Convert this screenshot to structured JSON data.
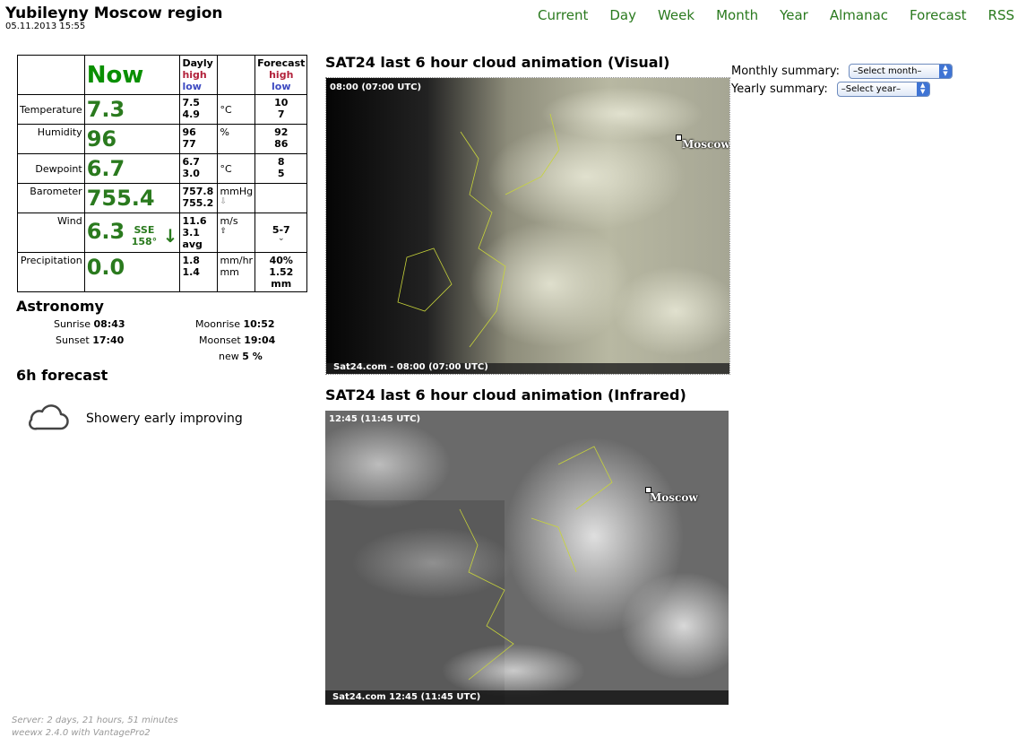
{
  "header": {
    "title": "Yubileyny Moscow region",
    "timestamp": "05.11.2013 15:55"
  },
  "nav": [
    "Current",
    "Day",
    "Week",
    "Month",
    "Year",
    "Almanac",
    "Forecast",
    "RSS"
  ],
  "table": {
    "now_label": "Now",
    "dayly_label": "Dayly",
    "forecast_label": "Forecast",
    "high": "high",
    "low": "low",
    "rows": [
      {
        "label": "Temperature",
        "now": "7.3",
        "hi": "7.5",
        "lo": "4.9",
        "unit": "°C",
        "fhi": "10",
        "flo": "7"
      },
      {
        "label": "Humidity",
        "now": "96",
        "hi": "96",
        "lo": "77",
        "unit": "%",
        "fhi": "92",
        "flo": "86"
      },
      {
        "label": "Dewpoint",
        "now": "6.7",
        "hi": "6.7",
        "lo": "3.0",
        "unit": "°C",
        "fhi": "8",
        "flo": "5"
      },
      {
        "label": "Barometer",
        "now": "755.4",
        "hi": "757.8",
        "lo": "755.2",
        "unit": "mmHg",
        "trend": "⇩",
        "fhi": "",
        "flo": ""
      },
      {
        "label": "Wind",
        "now": "6.3",
        "dir": "SSE",
        "deg": "158°",
        "arrow": "↓",
        "hi": "11.6",
        "lo": "3.1 avg",
        "unit": "m/s",
        "trend": "⇧",
        "fval": "5-7",
        "fsub": "⌄"
      },
      {
        "label": "Precipitation",
        "now": "0.0",
        "hi": "1.8",
        "lo": "1.4",
        "unit1": "mm/hr",
        "unit2": "mm",
        "fhi": "40%",
        "flo": "1.52",
        "fmm": "mm"
      }
    ]
  },
  "astronomy": {
    "title": "Astronomy",
    "sunrise_label": "Sunrise",
    "sunrise": "08:43",
    "sunset_label": "Sunset",
    "sunset": "17:40",
    "moonrise_label": "Moonrise",
    "moonrise": "10:52",
    "moonset_label": "Moonset",
    "moonset": "19:04",
    "phase_label": "new",
    "phase": "5 %"
  },
  "forecast6h": {
    "title": "6h forecast",
    "text": "Showery early improving",
    "icon": "cloud-icon"
  },
  "sat_visual": {
    "title": "SAT24 last 6 hour cloud animation (Visual)",
    "top_text": "08:00 (07:00 UTC)",
    "bottom_text": "Sat24.com - 08:00 (07:00 UTC)",
    "city": "Moscow"
  },
  "sat_ir": {
    "title": "SAT24 last 6 hour cloud animation (Infrared)",
    "top_text": "12:45 (11:45 UTC)",
    "bottom_text": "Sat24.com 12:45 (11:45 UTC)",
    "city": "Moscow"
  },
  "summary": {
    "monthly_label": "Monthly summary:",
    "monthly_select": "–Select month–",
    "yearly_label": "Yearly summary:",
    "yearly_select": "–Select year–"
  },
  "footer": {
    "server": "Server: 2 days, 21 hours, 51 minutes",
    "software": "weewx 2.4.0 with VantagePro2"
  },
  "colors": {
    "accent_green": "#2a7a1e",
    "high_red": "#b2223b",
    "low_blue": "#3d4ac1"
  }
}
